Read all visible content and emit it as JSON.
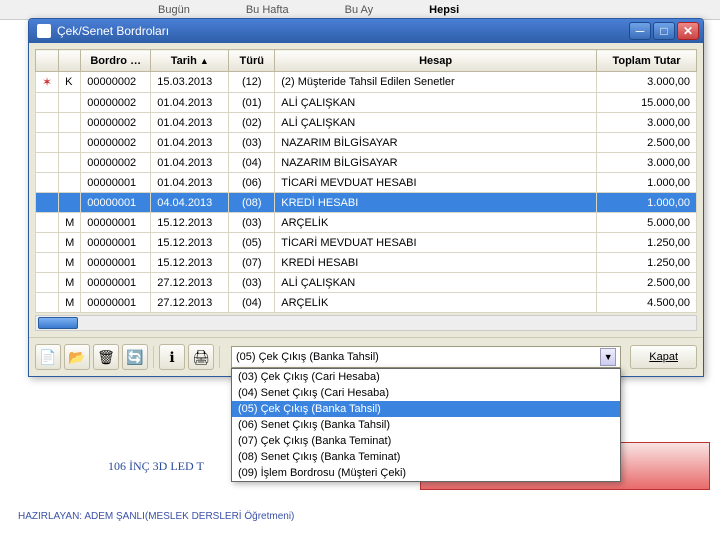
{
  "bg_tabs": {
    "t1": "Bugün",
    "t2": "Bu Hafta",
    "t3": "Bu Ay",
    "t4": "Hepsi"
  },
  "window": {
    "title": "Çek/Senet Bordroları",
    "columns": {
      "flag": "",
      "k": "",
      "bordro": "Bordro …",
      "tarih": "Tarih",
      "turu": "Türü",
      "hesap": "Hesap",
      "tutar": "Toplam Tutar"
    },
    "rows": [
      {
        "flag": "✶",
        "k": "K",
        "bordro": "00000002",
        "tarih": "15.03.2013",
        "turu": "(12)",
        "hesap": "(2) Müşteride Tahsil Edilen Senetler",
        "tutar": "3.000,00"
      },
      {
        "flag": "",
        "k": "",
        "bordro": "00000002",
        "tarih": "01.04.2013",
        "turu": "(01)",
        "hesap": "ALİ ÇALIŞKAN",
        "tutar": "15.000,00"
      },
      {
        "flag": "",
        "k": "",
        "bordro": "00000002",
        "tarih": "01.04.2013",
        "turu": "(02)",
        "hesap": "ALİ ÇALIŞKAN",
        "tutar": "3.000,00"
      },
      {
        "flag": "",
        "k": "",
        "bordro": "00000002",
        "tarih": "01.04.2013",
        "turu": "(03)",
        "hesap": "NAZARIM BİLGİSAYAR",
        "tutar": "2.500,00"
      },
      {
        "flag": "",
        "k": "",
        "bordro": "00000002",
        "tarih": "01.04.2013",
        "turu": "(04)",
        "hesap": "NAZARIM BİLGİSAYAR",
        "tutar": "3.000,00"
      },
      {
        "flag": "",
        "k": "",
        "bordro": "00000001",
        "tarih": "01.04.2013",
        "turu": "(06)",
        "hesap": "TİCARİ MEVDUAT HESABI",
        "tutar": "1.000,00"
      },
      {
        "flag": "",
        "k": "",
        "bordro": "00000001",
        "tarih": "04.04.2013",
        "turu": "(08)",
        "hesap": "KREDİ HESABI",
        "tutar": "1.000,00",
        "sel": true
      },
      {
        "flag": "",
        "k": "M",
        "bordro": "00000001",
        "tarih": "15.12.2013",
        "turu": "(03)",
        "hesap": "ARÇELİK",
        "tutar": "5.000,00"
      },
      {
        "flag": "",
        "k": "M",
        "bordro": "00000001",
        "tarih": "15.12.2013",
        "turu": "(05)",
        "hesap": "TİCARİ MEVDUAT HESABI",
        "tutar": "1.250,00"
      },
      {
        "flag": "",
        "k": "M",
        "bordro": "00000001",
        "tarih": "15.12.2013",
        "turu": "(07)",
        "hesap": "KREDİ HESABI",
        "tutar": "1.250,00"
      },
      {
        "flag": "",
        "k": "M",
        "bordro": "00000001",
        "tarih": "27.12.2013",
        "turu": "(03)",
        "hesap": "ALİ ÇALIŞKAN",
        "tutar": "2.500,00"
      },
      {
        "flag": "",
        "k": "M",
        "bordro": "00000001",
        "tarih": "27.12.2013",
        "turu": "(04)",
        "hesap": "ARÇELİK",
        "tutar": "4.500,00"
      }
    ],
    "combo": {
      "selected": "(05) Çek Çıkış    (Banka Tahsil)",
      "options": [
        {
          "text": "(03) Çek Çıkış    (Cari Hesaba)"
        },
        {
          "text": "(04) Senet Çıkış  (Cari Hesaba)"
        },
        {
          "text": "(05) Çek Çıkış    (Banka Tahsil)",
          "hl": true
        },
        {
          "text": "(06) Senet Çıkış (Banka Tahsil)"
        },
        {
          "text": "(07) Çek Çıkış    (Banka Teminat)"
        },
        {
          "text": "(08) Senet Çıkış (Banka Teminat)"
        },
        {
          "text": "(09) İşlem Bordrosu (Müşteri Çeki)"
        }
      ]
    },
    "close_label": "Kapat"
  },
  "bg_text": "106 İNÇ 3D LED T",
  "footer": "HAZIRLAYAN: ADEM ŞANLI(MESLEK DERSLERİ Öğretmeni)"
}
